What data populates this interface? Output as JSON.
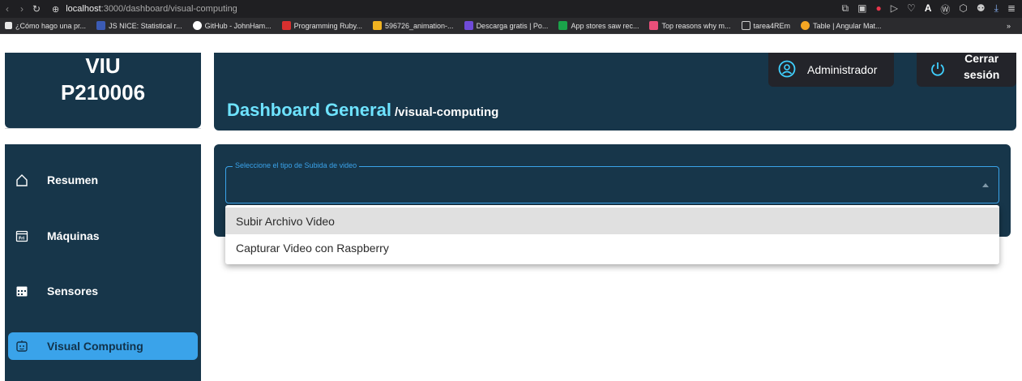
{
  "browser": {
    "url_host": "localhost",
    "url_path": ":3000/dashboard/visual-computing",
    "bookmarks": [
      {
        "label": "¿Cómo hago una pr...",
        "color": "#e8e8e8"
      },
      {
        "label": "JS NICE: Statistical r...",
        "color": "#3b5bb5"
      },
      {
        "label": "GitHub - JohnHam...",
        "color": "#ffffff"
      },
      {
        "label": "Programming Ruby...",
        "color": "#d9302f"
      },
      {
        "label": "596726_animation-...",
        "color": "#f1b321"
      },
      {
        "label": "Descarga gratis | Po...",
        "color": "#6f4bd8"
      },
      {
        "label": "App stores saw rec...",
        "color": "#1aa34a"
      },
      {
        "label": "Top reasons why m...",
        "color": "#e94f7a"
      },
      {
        "label": "tarea4REm",
        "color": "#cfcfcf"
      },
      {
        "label": "Table | Angular Mat...",
        "color": "#f5a623"
      }
    ],
    "more": "»"
  },
  "brand": {
    "line1": "VIU",
    "line2": "P210006"
  },
  "sidebar": {
    "items": [
      {
        "label": "Resumen",
        "icon": "home-icon",
        "active": false
      },
      {
        "label": "Máquinas",
        "icon": "calendar-icon",
        "active": false
      },
      {
        "label": "Sensores",
        "icon": "calendar-grid-icon",
        "active": false
      },
      {
        "label": "Visual Computing",
        "icon": "robot-face-icon",
        "active": true
      }
    ]
  },
  "header": {
    "title": "Dashboard General",
    "route": "/visual-computing",
    "user_label": "Administrador",
    "logout_line1": "Cerrar",
    "logout_line2": "sesión"
  },
  "upload": {
    "select_label": "Seleccione el tipo de Subida de video",
    "options": [
      "Subir Archivo Video",
      "Capturar Video con Raspberry"
    ],
    "highlighted_index": 0
  },
  "colors": {
    "navy": "#17364a",
    "accent": "#3aa3ea",
    "title": "#6ee3ff"
  }
}
